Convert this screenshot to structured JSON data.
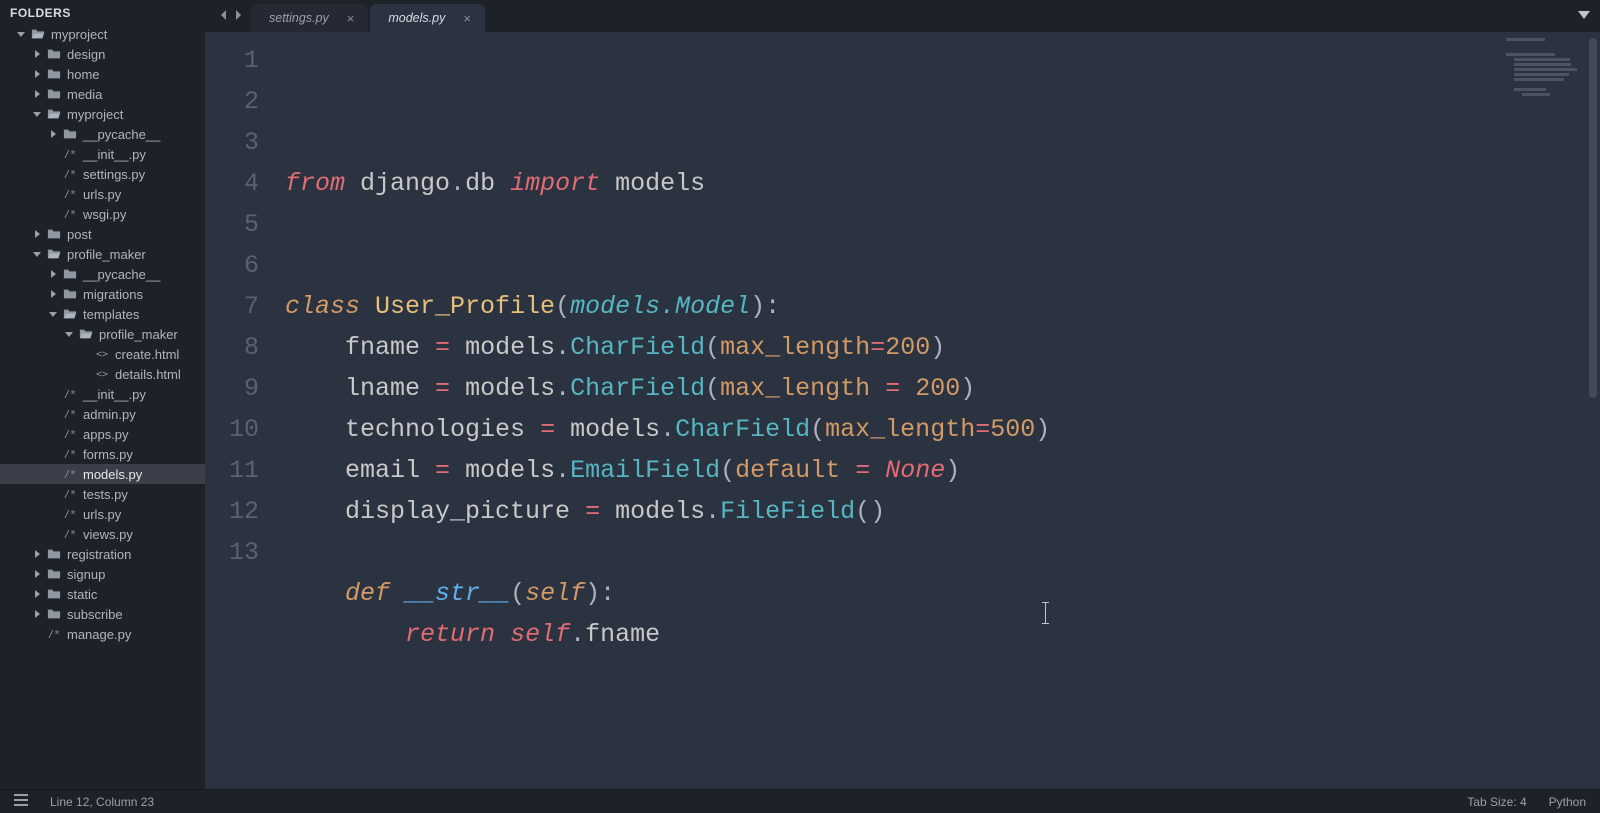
{
  "sidebar": {
    "header": "FOLDERS",
    "tree": [
      {
        "d": 0,
        "arrow": "down",
        "icon": "folder-open",
        "label": "myproject"
      },
      {
        "d": 1,
        "arrow": "right",
        "icon": "folder",
        "label": "design"
      },
      {
        "d": 1,
        "arrow": "right",
        "icon": "folder",
        "label": "home"
      },
      {
        "d": 1,
        "arrow": "right",
        "icon": "folder",
        "label": "media"
      },
      {
        "d": 1,
        "arrow": "down",
        "icon": "folder-open",
        "label": "myproject"
      },
      {
        "d": 2,
        "arrow": "right",
        "icon": "folder",
        "label": "__pycache__"
      },
      {
        "d": 2,
        "arrow": "none",
        "icon": "py",
        "label": "__init__.py"
      },
      {
        "d": 2,
        "arrow": "none",
        "icon": "py",
        "label": "settings.py"
      },
      {
        "d": 2,
        "arrow": "none",
        "icon": "py",
        "label": "urls.py"
      },
      {
        "d": 2,
        "arrow": "none",
        "icon": "py",
        "label": "wsgi.py"
      },
      {
        "d": 1,
        "arrow": "right",
        "icon": "folder",
        "label": "post"
      },
      {
        "d": 1,
        "arrow": "down",
        "icon": "folder-open",
        "label": "profile_maker"
      },
      {
        "d": 2,
        "arrow": "right",
        "icon": "folder",
        "label": "__pycache__"
      },
      {
        "d": 2,
        "arrow": "right",
        "icon": "folder",
        "label": "migrations"
      },
      {
        "d": 2,
        "arrow": "down",
        "icon": "folder-open",
        "label": "templates"
      },
      {
        "d": 3,
        "arrow": "down",
        "icon": "folder-open",
        "label": "profile_maker"
      },
      {
        "d": 4,
        "arrow": "none",
        "icon": "html",
        "label": "create.html"
      },
      {
        "d": 4,
        "arrow": "none",
        "icon": "html",
        "label": "details.html"
      },
      {
        "d": 2,
        "arrow": "none",
        "icon": "py",
        "label": "__init__.py"
      },
      {
        "d": 2,
        "arrow": "none",
        "icon": "py",
        "label": "admin.py"
      },
      {
        "d": 2,
        "arrow": "none",
        "icon": "py",
        "label": "apps.py"
      },
      {
        "d": 2,
        "arrow": "none",
        "icon": "py",
        "label": "forms.py"
      },
      {
        "d": 2,
        "arrow": "none",
        "icon": "py",
        "label": "models.py",
        "active": true
      },
      {
        "d": 2,
        "arrow": "none",
        "icon": "py",
        "label": "tests.py"
      },
      {
        "d": 2,
        "arrow": "none",
        "icon": "py",
        "label": "urls.py"
      },
      {
        "d": 2,
        "arrow": "none",
        "icon": "py",
        "label": "views.py"
      },
      {
        "d": 1,
        "arrow": "right",
        "icon": "folder",
        "label": "registration"
      },
      {
        "d": 1,
        "arrow": "right",
        "icon": "folder",
        "label": "signup"
      },
      {
        "d": 1,
        "arrow": "right",
        "icon": "folder",
        "label": "static"
      },
      {
        "d": 1,
        "arrow": "right",
        "icon": "folder",
        "label": "subscribe"
      },
      {
        "d": 1,
        "arrow": "none",
        "icon": "py",
        "label": "manage.py"
      }
    ]
  },
  "tabs": [
    {
      "label": "settings.py",
      "active": false
    },
    {
      "label": "models.py",
      "active": true
    }
  ],
  "code": {
    "lines": [
      [
        {
          "t": "from",
          "c": "kw-red"
        },
        {
          "t": " "
        },
        {
          "t": "django",
          "c": "name"
        },
        {
          "t": ".",
          "c": "dot"
        },
        {
          "t": "db",
          "c": "name"
        },
        {
          "t": " "
        },
        {
          "t": "import",
          "c": "kw-red"
        },
        {
          "t": " "
        },
        {
          "t": "models",
          "c": "name"
        }
      ],
      [],
      [],
      [
        {
          "t": "class",
          "c": "kw-storage"
        },
        {
          "t": " "
        },
        {
          "t": "User_Profile",
          "c": "classname"
        },
        {
          "t": "(",
          "c": "punct"
        },
        {
          "t": "models",
          "c": "param2"
        },
        {
          "t": ".",
          "c": "param2"
        },
        {
          "t": "Model",
          "c": "param2"
        },
        {
          "t": ")",
          "c": "punct"
        },
        {
          "t": ":",
          "c": "punct"
        }
      ],
      [
        {
          "t": "    "
        },
        {
          "t": "fname",
          "c": "name"
        },
        {
          "t": " "
        },
        {
          "t": "=",
          "c": "kw-red"
        },
        {
          "t": " "
        },
        {
          "t": "models",
          "c": "name"
        },
        {
          "t": ".",
          "c": "dot"
        },
        {
          "t": "CharField",
          "c": "funccall"
        },
        {
          "t": "(",
          "c": "punct"
        },
        {
          "t": "max_length",
          "c": "kwarg"
        },
        {
          "t": "=",
          "c": "kw-red"
        },
        {
          "t": "200",
          "c": "num"
        },
        {
          "t": ")",
          "c": "punct"
        }
      ],
      [
        {
          "t": "    "
        },
        {
          "t": "lname",
          "c": "name"
        },
        {
          "t": " "
        },
        {
          "t": "=",
          "c": "kw-red"
        },
        {
          "t": " "
        },
        {
          "t": "models",
          "c": "name"
        },
        {
          "t": ".",
          "c": "dot"
        },
        {
          "t": "CharField",
          "c": "funccall"
        },
        {
          "t": "(",
          "c": "punct"
        },
        {
          "t": "max_length",
          "c": "kwarg"
        },
        {
          "t": " "
        },
        {
          "t": "=",
          "c": "kw-red"
        },
        {
          "t": " "
        },
        {
          "t": "200",
          "c": "num"
        },
        {
          "t": ")",
          "c": "punct"
        }
      ],
      [
        {
          "t": "    "
        },
        {
          "t": "technologies",
          "c": "name"
        },
        {
          "t": " "
        },
        {
          "t": "=",
          "c": "kw-red"
        },
        {
          "t": " "
        },
        {
          "t": "models",
          "c": "name"
        },
        {
          "t": ".",
          "c": "dot"
        },
        {
          "t": "CharField",
          "c": "funccall"
        },
        {
          "t": "(",
          "c": "punct"
        },
        {
          "t": "max_length",
          "c": "kwarg"
        },
        {
          "t": "=",
          "c": "kw-red"
        },
        {
          "t": "500",
          "c": "num"
        },
        {
          "t": ")",
          "c": "punct"
        }
      ],
      [
        {
          "t": "    "
        },
        {
          "t": "email",
          "c": "name"
        },
        {
          "t": " "
        },
        {
          "t": "=",
          "c": "kw-red"
        },
        {
          "t": " "
        },
        {
          "t": "models",
          "c": "name"
        },
        {
          "t": ".",
          "c": "dot"
        },
        {
          "t": "EmailField",
          "c": "funccall"
        },
        {
          "t": "(",
          "c": "punct"
        },
        {
          "t": "default",
          "c": "kwarg"
        },
        {
          "t": " "
        },
        {
          "t": "=",
          "c": "kw-red"
        },
        {
          "t": " "
        },
        {
          "t": "None",
          "c": "const"
        },
        {
          "t": ")",
          "c": "punct"
        }
      ],
      [
        {
          "t": "    "
        },
        {
          "t": "display_picture",
          "c": "name"
        },
        {
          "t": " "
        },
        {
          "t": "=",
          "c": "kw-red"
        },
        {
          "t": " "
        },
        {
          "t": "models",
          "c": "name"
        },
        {
          "t": ".",
          "c": "dot"
        },
        {
          "t": "FileField",
          "c": "funccall"
        },
        {
          "t": "(",
          "c": "punct"
        },
        {
          "t": ")",
          "c": "punct"
        }
      ],
      [],
      [
        {
          "t": "    "
        },
        {
          "t": "def",
          "c": "kw-storage"
        },
        {
          "t": " "
        },
        {
          "t": "__str__",
          "c": "defname"
        },
        {
          "t": "(",
          "c": "punct"
        },
        {
          "t": "self",
          "c": "self"
        },
        {
          "t": ")",
          "c": "punct"
        },
        {
          "t": ":",
          "c": "punct"
        }
      ],
      [
        {
          "t": "        "
        },
        {
          "t": "return",
          "c": "kw-red"
        },
        {
          "t": " "
        },
        {
          "t": "self",
          "c": "const"
        },
        {
          "t": ".",
          "c": "dot"
        },
        {
          "t": "fname",
          "c": "name"
        }
      ],
      []
    ],
    "highlight_line": 12
  },
  "status": {
    "position": "Line 12, Column 23",
    "tabsize": "Tab Size: 4",
    "language": "Python"
  }
}
